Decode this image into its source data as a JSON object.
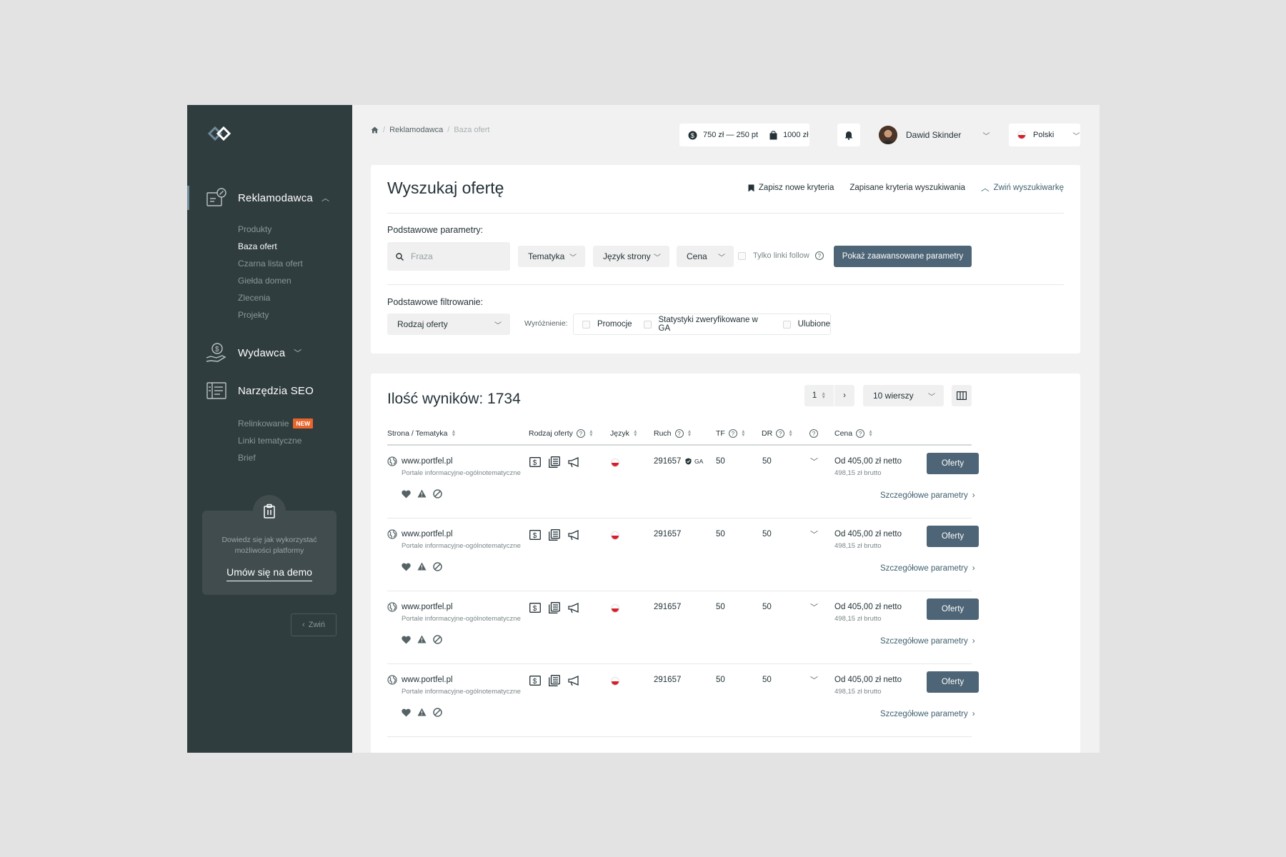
{
  "sidebar": {
    "advertiser": {
      "title": "Reklamodawca",
      "items": [
        "Produkty",
        "Baza ofert",
        "Czarna lista ofert",
        "Giełda domen",
        "Zlecenia",
        "Projekty"
      ],
      "active_index": 1
    },
    "publisher": {
      "title": "Wydawca"
    },
    "seo_tools": {
      "title": "Narzędzia SEO",
      "items": [
        "Relinkowanie",
        "Linki tematyczne",
        "Brief"
      ],
      "new_badge": "NEW"
    },
    "demo": {
      "text_line1": "Dowiedz się jak wykorzystać",
      "text_line2": "możliwości platformy",
      "link": "Umów się na demo"
    },
    "collapse_label": "Zwiń"
  },
  "topbar": {
    "breadcrumb": [
      "Reklamodawca",
      "Baza ofert"
    ],
    "balance": "750 zł — 250 pt",
    "cart": "1000 zł",
    "user_name": "Dawid Skinder",
    "language": "Polski"
  },
  "search": {
    "title": "Wyszukaj ofertę",
    "save_criteria": "Zapisz nowe kryteria",
    "saved_criteria": "Zapisane kryteria wyszukiwania",
    "collapse": "Zwiń wyszukiwarkę",
    "basic_params_label": "Podstawowe parametry:",
    "phrase_placeholder": "Fraza",
    "topic": "Tematyka",
    "language": "Język strony",
    "price": "Cena",
    "follow_only": "Tylko linki follow",
    "advanced_button": "Pokaż zaawansowane parametry",
    "basic_filter_label": "Podstawowe filtrowanie:",
    "offer_type": "Rodzaj oferty",
    "highlight_label": "Wyróżnienie:",
    "highlight_options": [
      "Promocje",
      "Statystyki zweryfikowane w GA",
      "Ulubione"
    ]
  },
  "results": {
    "title": "Ilość wyników: 1734",
    "page": "1",
    "rows_per_page": "10 wierszy",
    "columns": {
      "site": "Strona / Tematyka",
      "offer_type": "Rodzaj oferty",
      "language": "Język",
      "traffic": "Ruch",
      "tf": "TF",
      "dr": "DR",
      "price": "Cena"
    },
    "rows": [
      {
        "site": "www.portfel.pl",
        "topic": "Portale informacyjne-ogólnotematyczne",
        "traffic": "291657",
        "ga": "GA",
        "tf": "50",
        "dr": "50",
        "price_net": "Od 405,00 zł netto",
        "price_gross": "498,15 zł brutto",
        "button": "Oferty",
        "details": "Szczegółowe parametry"
      },
      {
        "site": "www.portfel.pl",
        "topic": "Portale informacyjne-ogólnotematyczne",
        "traffic": "291657",
        "ga": "",
        "tf": "50",
        "dr": "50",
        "price_net": "Od 405,00 zł netto",
        "price_gross": "498,15 zł brutto",
        "button": "Oferty",
        "details": "Szczegółowe parametry"
      },
      {
        "site": "www.portfel.pl",
        "topic": "Portale informacyjne-ogólnotematyczne",
        "traffic": "291657",
        "ga": "",
        "tf": "50",
        "dr": "50",
        "price_net": "Od 405,00 zł netto",
        "price_gross": "498,15 zł brutto",
        "button": "Oferty",
        "details": "Szczegółowe parametry"
      },
      {
        "site": "www.portfel.pl",
        "topic": "Portale informacyjne-ogólnotematyczne",
        "traffic": "291657",
        "ga": "",
        "tf": "50",
        "dr": "50",
        "price_net": "Od 405,00 zł netto",
        "price_gross": "498,15 zł brutto",
        "button": "Oferty",
        "details": "Szczegółowe parametry"
      }
    ]
  },
  "colors": {
    "sidebar_bg": "#303d3f",
    "accent": "#4d6576",
    "new_badge": "#e8652b"
  }
}
